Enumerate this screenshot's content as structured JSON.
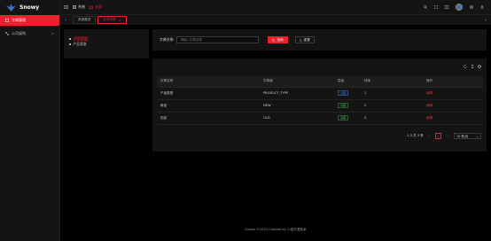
{
  "app": {
    "name": "Snowy"
  },
  "sidebar": {
    "active_item": {
      "label": "字典管理",
      "icon": "book-icon"
    },
    "group": {
      "label": "公司架构",
      "icon": "org-icon"
    }
  },
  "header": {
    "modules": [
      {
        "label": "系统",
        "icon": "grid-icon"
      },
      {
        "label": "业务",
        "icon": "briefcase-icon"
      }
    ],
    "right_icons": [
      "search-icon",
      "fullscreen-icon",
      "notification-icon",
      "avatar",
      "settings-icon",
      "user-icon"
    ]
  },
  "tabs": [
    {
      "label": "系统首页"
    },
    {
      "label": "业务字典"
    }
  ],
  "tree": {
    "items": [
      {
        "label": "产品类型"
      },
      {
        "label": "产品状态"
      }
    ]
  },
  "search": {
    "label": "字典名称:",
    "placeholder": "请输入字典名称",
    "search_label": "查询",
    "reset_label": "重置"
  },
  "table": {
    "columns": [
      "字典名称",
      "字典值",
      "层级",
      "排序",
      "操作"
    ],
    "rows": [
      {
        "name": "产品类型",
        "value": "PRODUCT_TYPE",
        "level": "上级",
        "level_color": "#4e8ff0",
        "sort": "1",
        "action": "编辑"
      },
      {
        "name": "新品",
        "value": "NEW",
        "level": "子级",
        "level_color": "#5bc45b",
        "sort": "2",
        "action": "编辑"
      },
      {
        "name": "旧品",
        "value": "OLD",
        "level": "子级",
        "level_color": "#5bc45b",
        "sort": "3",
        "action": "编辑"
      }
    ]
  },
  "pagination": {
    "summary": "1-3 共 3 条",
    "current_page": "1",
    "page_size": "10 条/页"
  },
  "footer": {
    "text": "Snowy ©2022 Created by 小诺开源技术"
  },
  "colors": {
    "accent": "#e8232e",
    "panel": "#141414",
    "background": "#000000"
  }
}
